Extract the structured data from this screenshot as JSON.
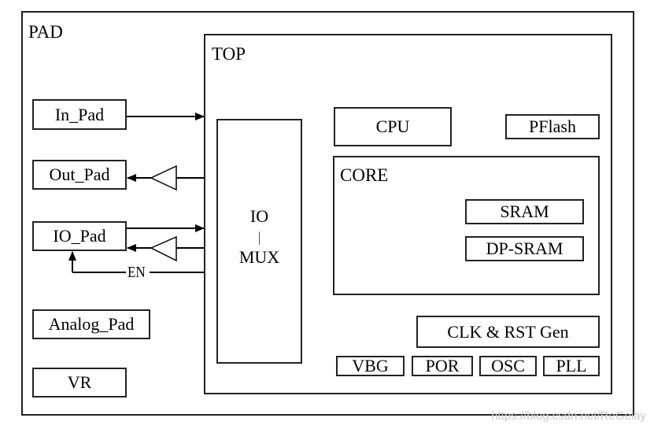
{
  "diagram": {
    "pad": {
      "title": "PAD"
    },
    "top": {
      "title": "TOP"
    },
    "pads": {
      "in_pad": "In_Pad",
      "out_pad": "Out_Pad",
      "io_pad": "IO_Pad",
      "analog_pad": "Analog_Pad",
      "vr": "VR"
    },
    "enable_label": "EN",
    "io_mux": {
      "line1": "IO",
      "separator": "|",
      "line2": "MUX"
    },
    "cpu": "CPU",
    "pflash": "PFlash",
    "core": {
      "title": "CORE",
      "sram": "SRAM",
      "dp_sram": "DP-SRAM"
    },
    "clk_rst_gen": "CLK & RST Gen",
    "analog_blocks": [
      "VBG",
      "POR",
      "OSC",
      "PLL"
    ]
  },
  "watermark": "https://blog.csdn.net/ReGeiay"
}
